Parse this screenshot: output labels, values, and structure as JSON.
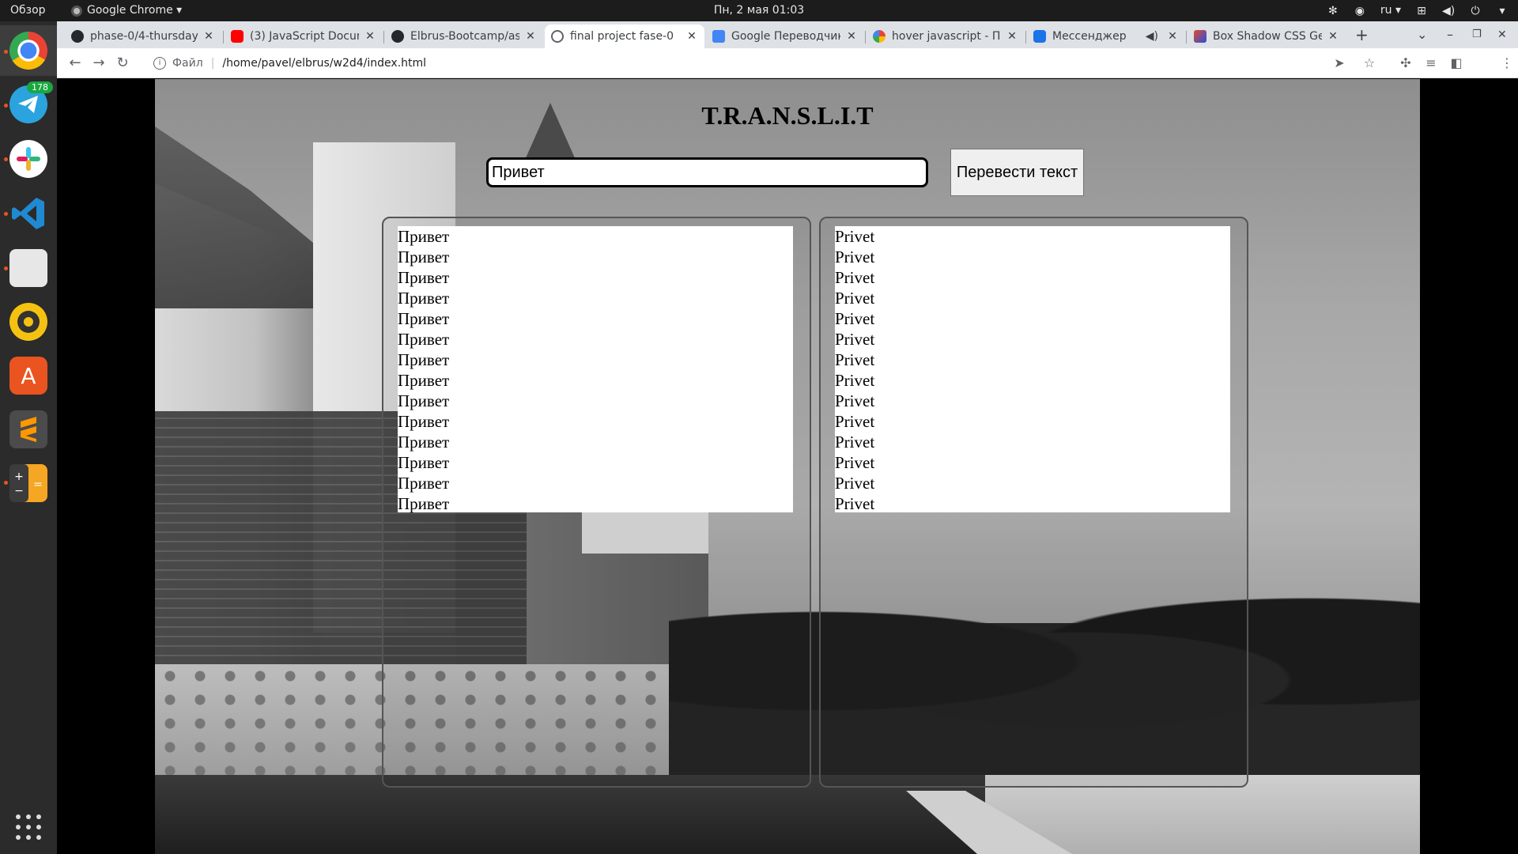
{
  "system": {
    "overview_label": "Обзор",
    "app_menu_label": "Google Chrome ▾",
    "clock": "Пн, 2 мая  01:03",
    "keyboard_layout": "ru ▾",
    "telegram_badge": "178"
  },
  "browser": {
    "tabs": [
      {
        "label": "phase-0/4-thursday...",
        "favicon": "github-icon",
        "active": false
      },
      {
        "label": "(3) JavaScript Docum...",
        "favicon": "youtube-icon",
        "active": false
      },
      {
        "label": "Elbrus-Bootcamp/as...",
        "favicon": "github-icon",
        "active": false
      },
      {
        "label": "final project fase-0",
        "favicon": "globe-icon",
        "active": true
      },
      {
        "label": "Google Переводчик",
        "favicon": "google-translate-icon",
        "active": false
      },
      {
        "label": "hover javascript - По...",
        "favicon": "google-icon",
        "active": false
      },
      {
        "label": "Мессенджер",
        "favicon": "messenger-icon",
        "active": false
      },
      {
        "label": "Box Shadow CSS Ge...",
        "favicon": "box-shadow-icon",
        "active": false
      }
    ],
    "address": {
      "scheme_label": "Файл",
      "path": "/home/pavel/elbrus/w2d4/index.html"
    }
  },
  "app": {
    "title": "T.R.A.N.S.L.I.T",
    "input_value": "Привет",
    "translate_button": "Перевести текст",
    "source_items": [
      "Привет",
      "Привет",
      "Привет",
      "Привет",
      "Привет",
      "Привет",
      "Привет",
      "Привет",
      "Привет",
      "Привет",
      "Привет",
      "Привет",
      "Привет",
      "Привет"
    ],
    "result_items": [
      "Privet",
      "Privet",
      "Privet",
      "Privet",
      "Privet",
      "Privet",
      "Privet",
      "Privet",
      "Privet",
      "Privet",
      "Privet",
      "Privet",
      "Privet",
      "Privet"
    ]
  },
  "colors": {
    "ubuntu_accent": "#e95420",
    "chrome_tabstrip": "#dee1e6"
  }
}
